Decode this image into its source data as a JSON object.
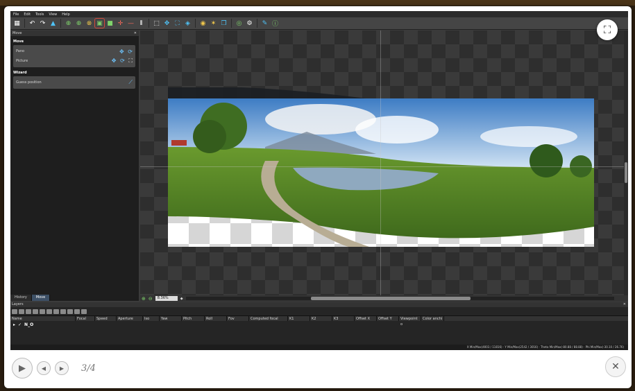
{
  "menu": [
    "File",
    "Edit",
    "Tools",
    "View",
    "Help"
  ],
  "left_panel": {
    "title": "Move",
    "section_move": "Move",
    "rows": [
      {
        "label": "Pano"
      },
      {
        "label": "Picture"
      }
    ],
    "section_wizard": "Wizard",
    "wizard_row": "Guess position",
    "tabs": [
      {
        "label": "History"
      },
      {
        "label": "Move"
      }
    ]
  },
  "viewport": {
    "zoom": "8.36%"
  },
  "layers": {
    "title": "Layers",
    "columns": [
      "Name",
      "Focal",
      "Speed",
      "Aperture",
      "Iso",
      "Yaw",
      "Pitch",
      "Roll",
      "Fov",
      "Computed focal",
      "K1",
      "K2",
      "K3",
      "Offset X",
      "Offset Y",
      "Viewpoint o",
      "Color anchi"
    ],
    "row": {
      "expander": "▸",
      "check": "✓",
      "name": "N_O"
    }
  },
  "info_bar": "X Min/Max(4003 / 11816)  ·  Y Min/Max(2542 / 3016)  ·  Theta Min/Max(-80.88 / 88.88)  ·  Phi Min/Max(-30.10 / 26.76)",
  "lightbox": {
    "counter": "3/4"
  },
  "colors": {
    "accent": "#3d5066",
    "selection": "#d24a3a"
  }
}
